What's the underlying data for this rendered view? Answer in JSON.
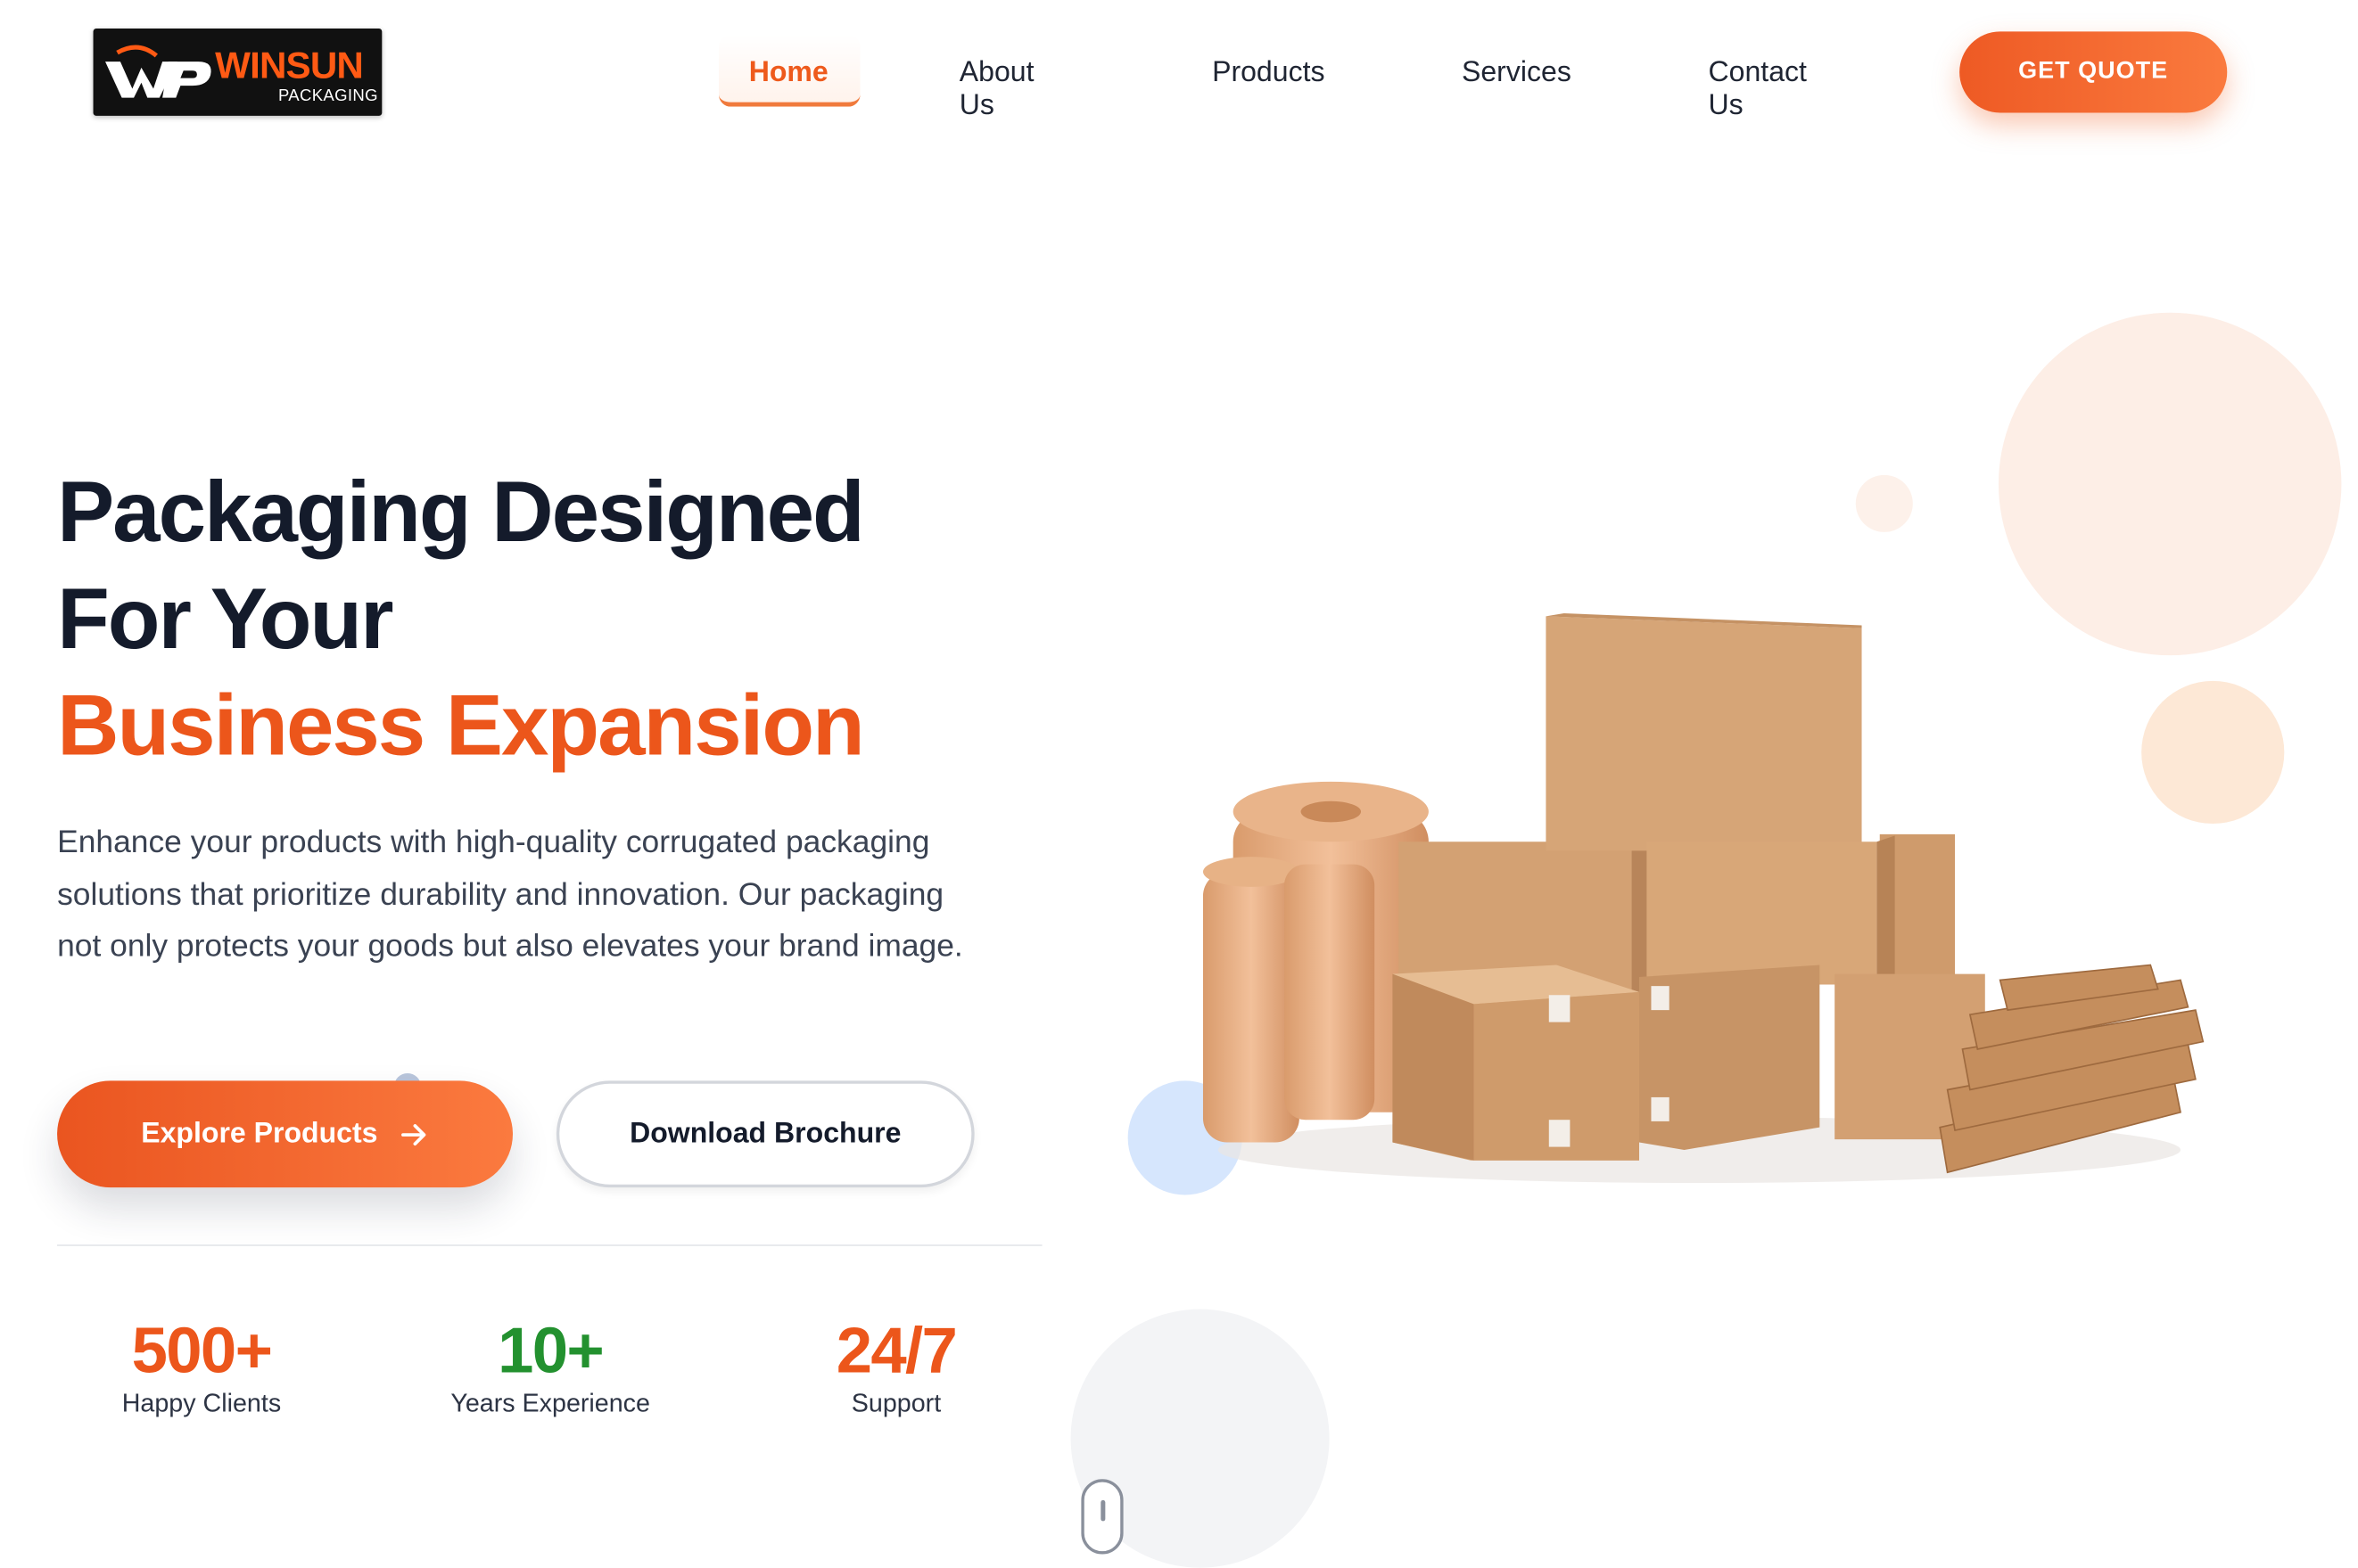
{
  "logo": {
    "brand": "WINSUN",
    "sub": "PACKAGING"
  },
  "nav": {
    "items": [
      "Home",
      "About Us",
      "Products",
      "Services",
      "Contact Us"
    ],
    "active": "Home",
    "cta": "GET QUOTE"
  },
  "hero": {
    "title_line1": "Packaging Designed",
    "title_line2": "For Your",
    "title_accent": "Business Expansion",
    "lead": "Enhance your products with high-quality corrugated packaging solutions that prioritize durability and innovation. Our packaging not only protects your goods but also elevates your brand image.",
    "primary_button": "Explore Products",
    "secondary_button": "Download Brochure"
  },
  "stats": [
    {
      "value": "500+",
      "label": "Happy Clients"
    },
    {
      "value": "10+",
      "label": "Years Experience"
    },
    {
      "value": "24/7",
      "label": "Support"
    }
  ],
  "colors": {
    "accent": "#ec561b",
    "green": "#23912f",
    "text": "#141b2b"
  },
  "icons": {
    "primary_button_icon": "arrow-right-icon",
    "scroll": "mouse-scroll-icon"
  }
}
